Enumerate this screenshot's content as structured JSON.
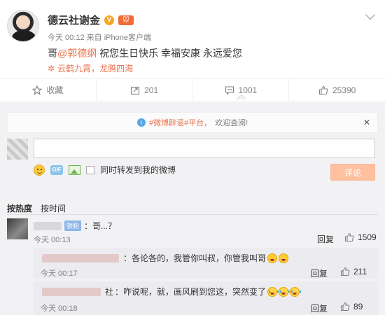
{
  "post": {
    "author": "德云社谢金",
    "verified_badge": "V",
    "vip_badge": "🐭",
    "time": "今天 00:12",
    "source_prefix": "来自",
    "source": "iPhone客户端",
    "text_prefix": "哥",
    "mention": "@郭德纲",
    "text_suffix": " 祝您生日快乐 幸福安康 永远爱您",
    "location": "云鹤九霄，龙腾四海"
  },
  "actions": {
    "favorite": "收藏",
    "repost": "201",
    "comment": "1001",
    "like": "25390"
  },
  "notice": {
    "link": "#微博辟谣#平台，",
    "text": "欢迎查阅!"
  },
  "composer": {
    "placeholder": "",
    "repost_option": "同时转发到我的微博",
    "submit": "评论"
  },
  "sort": {
    "by_heat": "按热度",
    "by_time": "按时间"
  },
  "comments": [
    {
      "badge": "铁粉",
      "text": "：哥...？",
      "time": "今天 00:13",
      "reply": "回复",
      "likes": "1509"
    }
  ],
  "replies": [
    {
      "text": "：各论各的，我管你叫叔，你管我叫哥",
      "time": "今天 00:17",
      "reply": "回复",
      "likes": "211"
    },
    {
      "name_tail": "社",
      "text": "：咋说呢，就，画风刷到您这，突然变了",
      "time": "今天 00:18",
      "reply": "回复",
      "likes": "89"
    }
  ],
  "colors": {
    "accent": "#eb7350",
    "muted": "#808080",
    "comment_bg": "#f2f2f5",
    "submit_bg": "#ffc09f"
  }
}
